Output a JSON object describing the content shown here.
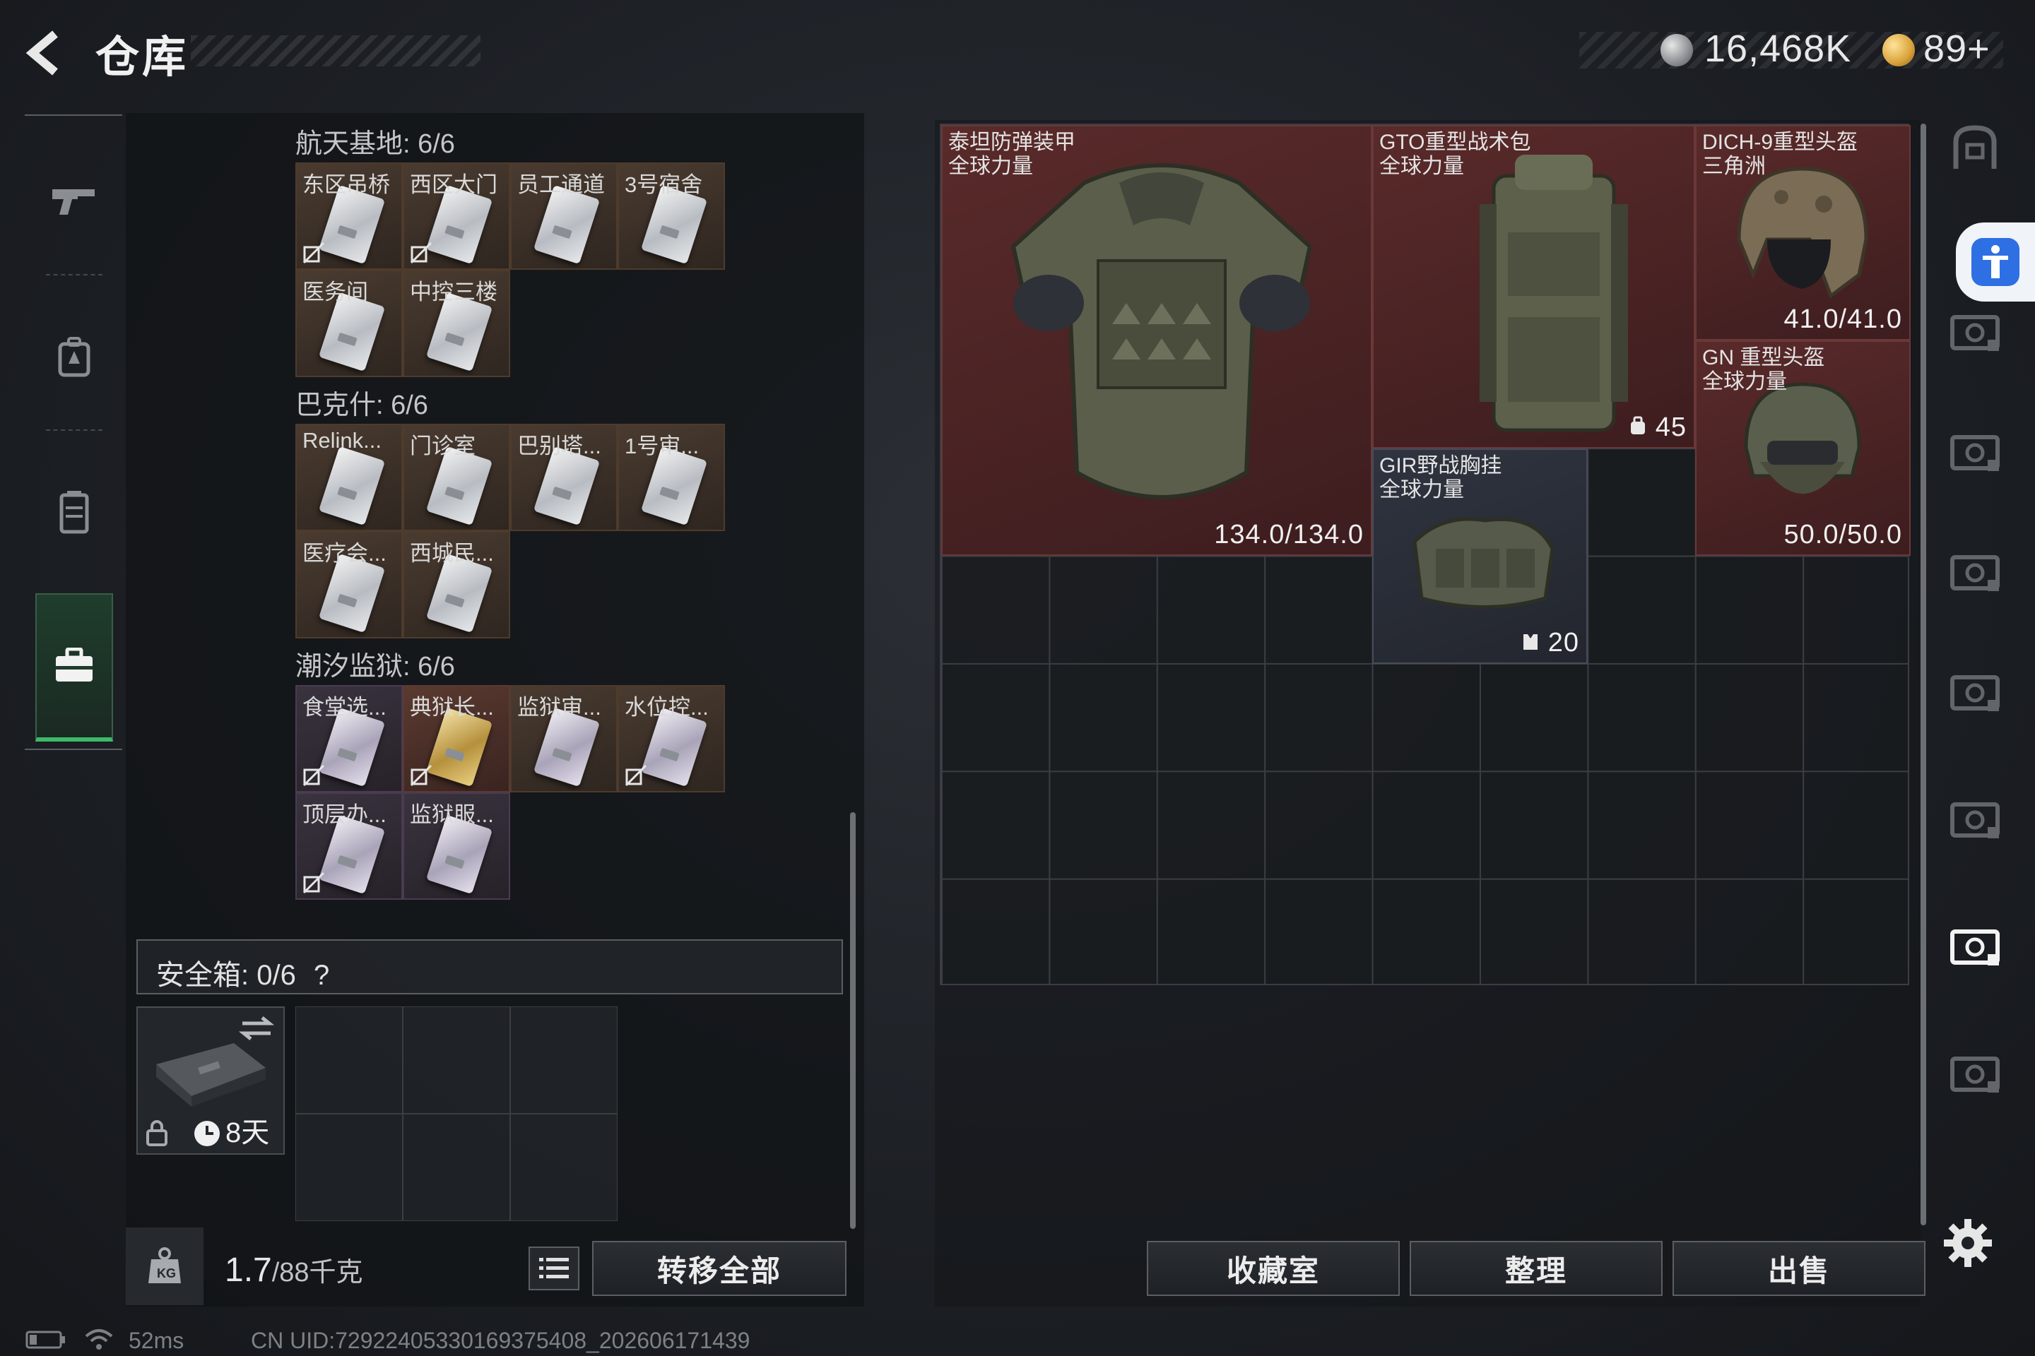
{
  "header": {
    "title": "仓库",
    "currency_1": "16,468K",
    "currency_2": "89+"
  },
  "left_rail": {
    "items": [
      {
        "name": "weapon-tab-icon"
      },
      {
        "name": "backpack-tab-icon"
      },
      {
        "name": "vest-tab-icon"
      },
      {
        "name": "case-tab-icon",
        "active": true
      }
    ]
  },
  "keys": {
    "groups": [
      {
        "title": "航天基地: 6/6",
        "cells": [
          {
            "label": "东区吊桥",
            "rarity": "orange",
            "card": "silver",
            "no_discard": true
          },
          {
            "label": "西区大门",
            "rarity": "orange",
            "card": "silver",
            "no_discard": true
          },
          {
            "label": "员工通道",
            "rarity": "orange",
            "card": "silver",
            "no_discard": false
          },
          {
            "label": "3号宿舍",
            "rarity": "orange",
            "card": "silver",
            "no_discard": false
          },
          {
            "label": "医务间",
            "rarity": "orange",
            "card": "silver",
            "no_discard": false
          },
          {
            "label": "中控三楼",
            "rarity": "orange",
            "card": "silver",
            "no_discard": false
          }
        ]
      },
      {
        "title": "巴克什: 6/6",
        "cells": [
          {
            "label": "Relink...",
            "rarity": "orange",
            "card": "silver",
            "no_discard": false
          },
          {
            "label": "门诊室",
            "rarity": "orange",
            "card": "silver",
            "no_discard": false
          },
          {
            "label": "巴别塔...",
            "rarity": "orange",
            "card": "silver",
            "no_discard": false
          },
          {
            "label": "1号审...",
            "rarity": "orange",
            "card": "silver",
            "no_discard": false
          },
          {
            "label": "医疗会...",
            "rarity": "orange",
            "card": "silver",
            "no_discard": false
          },
          {
            "label": "西城民...",
            "rarity": "orange",
            "card": "silver",
            "no_discard": false
          }
        ]
      },
      {
        "title": "潮汐监狱: 6/6",
        "cells": [
          {
            "label": "食堂选...",
            "rarity": "purple",
            "card": "purple",
            "no_discard": true
          },
          {
            "label": "典狱长...",
            "rarity": "red",
            "card": "gold",
            "no_discard": true
          },
          {
            "label": "监狱审...",
            "rarity": "orange",
            "card": "purple",
            "no_discard": false
          },
          {
            "label": "水位控...",
            "rarity": "orange",
            "card": "purple",
            "no_discard": true
          },
          {
            "label": "顶层办...",
            "rarity": "purple",
            "card": "purple",
            "no_discard": true
          },
          {
            "label": "监狱服...",
            "rarity": "purple",
            "card": "purple",
            "no_discard": false
          }
        ]
      }
    ]
  },
  "safe_box": {
    "label": "安全箱:",
    "count": "0/6",
    "help": "?",
    "timer": "8天"
  },
  "bottom_left": {
    "weight": "1.7",
    "weight_max": "/88千克",
    "transfer_all": "转移全部"
  },
  "stash_items": [
    {
      "name": "泰坦防弹装甲",
      "sub": "全球力量",
      "value": "134.0/134.0",
      "rarity": "red"
    },
    {
      "name": "GTO重型战术包",
      "sub": "全球力量",
      "value": "45",
      "rarity": "red"
    },
    {
      "name": "DICH-9重型头盔",
      "sub": "三角洲",
      "value": "41.0/41.0",
      "rarity": "red"
    },
    {
      "name": "GN 重型头盔",
      "sub": "全球力量",
      "value": "50.0/50.0",
      "rarity": "red"
    },
    {
      "name": "GIR野战胸挂",
      "sub": "全球力量",
      "value": "20",
      "rarity": "blue"
    }
  ],
  "bottom_right": {
    "collection": "收藏室",
    "organize": "整理",
    "sell": "出售"
  },
  "right_rail": {
    "tabs": [
      "stash-tab-1",
      "stash-tab-2",
      "stash-tab-3",
      "stash-tab-4",
      "stash-tab-5",
      "stash-tab-6",
      "stash-tab-7",
      "stash-tab-8"
    ]
  },
  "status_bar": {
    "ping": "52ms",
    "uid": "CN UID:72922405330169375408_202606171439"
  },
  "colors": {
    "accent_green": "#3fb86a",
    "rarity_red": "#5a2a2a",
    "rarity_orange": "#4a3b30",
    "rarity_purple": "#3a3340",
    "accessibility_blue": "#2f6fe4"
  }
}
